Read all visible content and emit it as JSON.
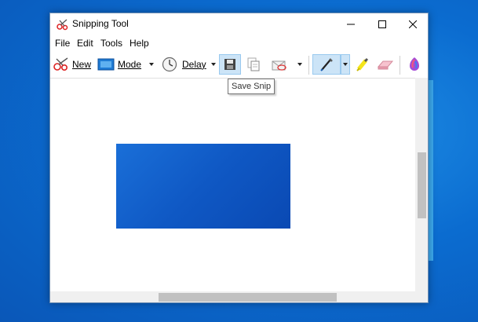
{
  "window": {
    "title": "Snipping Tool",
    "controls": {
      "minimize": "minimize",
      "maximize": "maximize",
      "close": "close"
    }
  },
  "menu": [
    "File",
    "Edit",
    "Tools",
    "Help"
  ],
  "toolbar": {
    "new_label": "New",
    "mode_label": "Mode",
    "delay_label": "Delay"
  },
  "tooltip": {
    "save_snip": "Save Snip"
  },
  "colors": {
    "desktop": "#0b6cd0",
    "snip_fill": "#0f58c4",
    "pressed_bg": "#cce4f7",
    "highlighter": "#f5e51a",
    "eraser": "#f2a7b8"
  }
}
